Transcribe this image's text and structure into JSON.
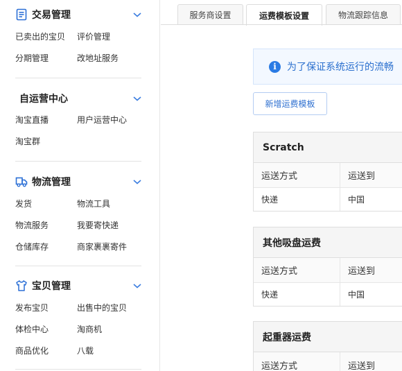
{
  "sidebar": {
    "groups": [
      {
        "title": "交易管理",
        "icon": "document-list-icon",
        "links": [
          "已卖出的宝贝",
          "评价管理",
          "分期管理",
          "改地址服务"
        ]
      },
      {
        "title": "自运营中心",
        "icon": "",
        "links": [
          "淘宝直播",
          "用户运营中心",
          "淘宝群"
        ]
      },
      {
        "title": "物流管理",
        "icon": "delivery-truck-icon",
        "links": [
          "发货",
          "物流工具",
          "物流服务",
          "我要寄快递",
          "仓储库存",
          "商家裹裹寄件"
        ]
      },
      {
        "title": "宝贝管理",
        "icon": "shirt-icon",
        "links": [
          "发布宝贝",
          "出售中的宝贝",
          "体检中心",
          "淘商机",
          "商品优化",
          "八载"
        ]
      }
    ]
  },
  "tabs": [
    {
      "label": "服务商设置"
    },
    {
      "label": "运费模板设置"
    },
    {
      "label": "物流跟踪信息"
    }
  ],
  "notice": {
    "text": "为了保证系统运行的流畅",
    "icon": "info-icon"
  },
  "add_button": {
    "label": "新增运费模板"
  },
  "templates": [
    {
      "name": "Scratch",
      "columns": [
        "运送方式",
        "运送到"
      ],
      "rows": [
        [
          "快递",
          "中国"
        ]
      ]
    },
    {
      "name": "其他吸盘运费",
      "columns": [
        "运送方式",
        "运送到"
      ],
      "rows": [
        [
          "快递",
          "中国"
        ]
      ]
    },
    {
      "name": "起重器运费",
      "columns": [
        "运送方式",
        "运送到"
      ],
      "rows": []
    }
  ],
  "colors": {
    "accent": "#2b7be4",
    "chevron": "#3b7de0",
    "icon_blue": "#2b6fd6"
  }
}
